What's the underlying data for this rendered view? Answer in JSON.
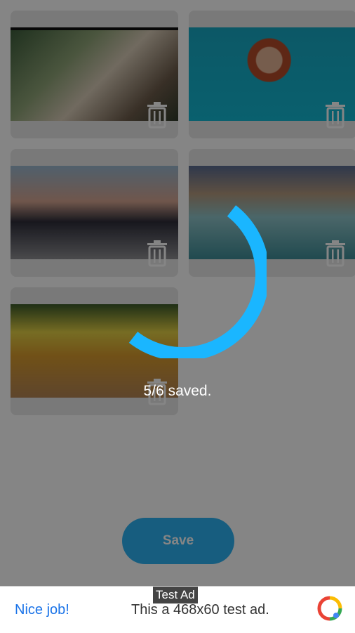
{
  "gallery": {
    "photos": [
      {
        "description": "selfie in park"
      },
      {
        "description": "woman with sunglasses selfie"
      },
      {
        "description": "couple selfie at Red Square"
      },
      {
        "description": "woman at Venice canal"
      },
      {
        "description": "blurred landscape"
      }
    ]
  },
  "actions": {
    "save_label": "Save"
  },
  "progress": {
    "status_text": "5/6 saved.",
    "saved": 5,
    "total": 6,
    "spinner_color": "#1ab6ff"
  },
  "ad": {
    "badge": "Test Ad",
    "left_text": "Nice job!",
    "main_text": "This a 468x60 test ad."
  },
  "colors": {
    "accent": "#2cb3f3",
    "link": "#1a73e8"
  }
}
